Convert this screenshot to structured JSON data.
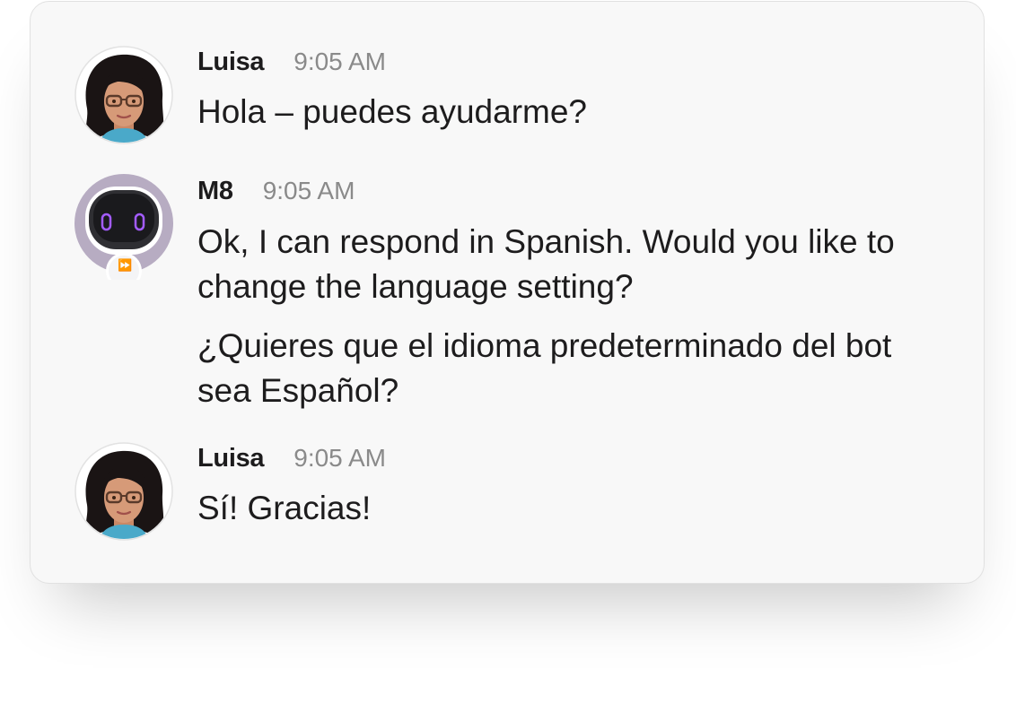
{
  "messages": [
    {
      "sender": "Luisa",
      "time": "9:05 AM",
      "avatar_icon": "woman-with-glasses-avatar-icon",
      "lines": [
        "Hola – puedes ayudarme?"
      ]
    },
    {
      "sender": "M8",
      "time": "9:05 AM",
      "avatar_icon": "robot-bot-avatar-icon",
      "lines": [
        "Ok, I can respond in Spanish. Would you like to change the language setting?",
        "¿Quieres que el idioma predeterminado del bot sea Español?"
      ]
    },
    {
      "sender": "Luisa",
      "time": "9:05 AM",
      "avatar_icon": "woman-with-glasses-avatar-icon",
      "lines": [
        "Sí! Gracias!"
      ]
    }
  ],
  "colors": {
    "card_bg": "#f8f8f8",
    "text": "#1d1c1d",
    "timestamp": "#8a8a8a",
    "bot_accent": "#8b3dff"
  }
}
